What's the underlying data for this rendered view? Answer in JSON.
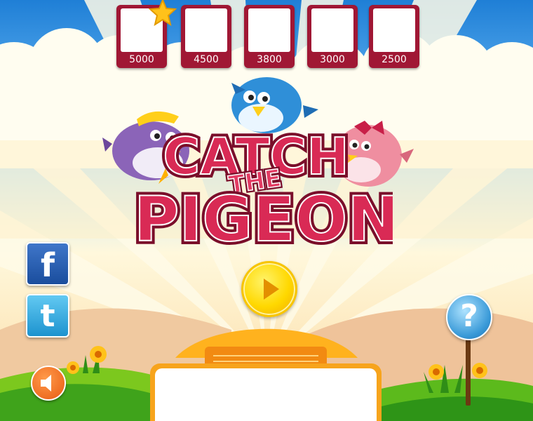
{
  "scores": [
    {
      "value": "5000",
      "starred": true
    },
    {
      "value": "4500",
      "starred": false
    },
    {
      "value": "3800",
      "starred": false
    },
    {
      "value": "3000",
      "starred": false
    },
    {
      "value": "2500",
      "starred": false
    }
  ],
  "logo": {
    "line1": "CATCH",
    "line2": "THE",
    "line3": "PIGEON"
  },
  "icons": {
    "facebook": "f",
    "twitter": "t",
    "help": "?"
  },
  "colors": {
    "score_frame": "#a01734",
    "logo_fill": "#c8204a",
    "play_yellow": "#ffd800",
    "panel_orange": "#f7a41c",
    "sound_orange": "#e85b12",
    "help_blue": "#3a9ad8",
    "facebook_blue": "#1a4d9d",
    "twitter_blue": "#1d93cf"
  }
}
